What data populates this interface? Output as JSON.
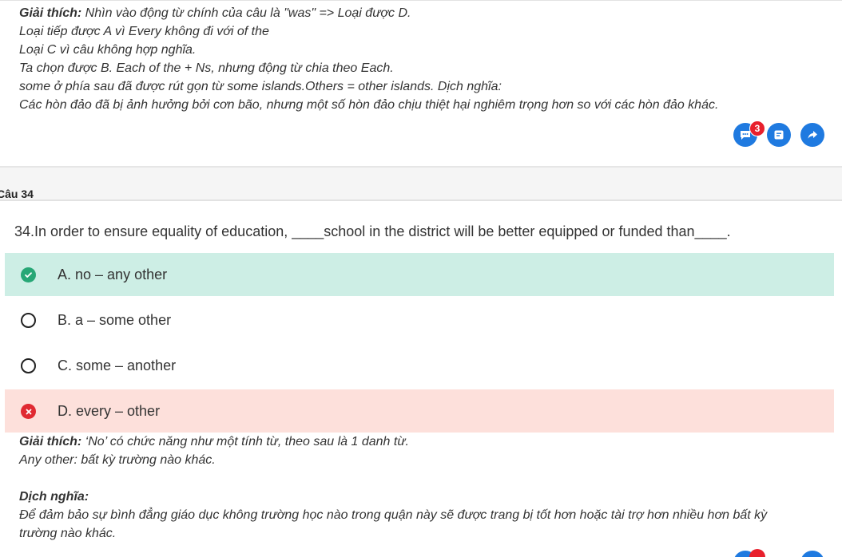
{
  "top_explanation": {
    "label": "Giải thích:",
    "first_line": " Nhìn vào động từ chính của câu là \"was\" => Loại được D.",
    "lines": [
      "Loại tiếp được A vì Every không đi với of the",
      "Loại C vì câu không hợp nghĩa.",
      "Ta chọn được B. Each of the + Ns, nhưng động từ chia theo Each.",
      "some ở phía sau đã được rút gọn từ some islands.Others = other islands. Dịch nghĩa:",
      "Các hòn đảo đã bị ảnh hưởng bởi cơn bão, nhưng một số hòn đảo chịu thiệt hại nghiêm trọng hơn so với các hòn đảo khác."
    ]
  },
  "actions": {
    "comment_badge_count": "3",
    "comment_icon": "comment-dots-icon",
    "note_icon": "note-icon",
    "share_icon": "share-arrow-icon",
    "accent_color": "#1f7ae0",
    "badge_color": "#e8202d"
  },
  "question": {
    "number_label": "Câu 34",
    "text": "34.In order to ensure equality of education, ____school in the district will be better equipped or funded than____."
  },
  "options": [
    {
      "label": "A. no – any other",
      "state": "correct"
    },
    {
      "label": "B. a – some other",
      "state": "unselected"
    },
    {
      "label": "C. some – another",
      "state": "unselected"
    },
    {
      "label": "D. every – other",
      "state": "wrong"
    }
  ],
  "bottom_explanation": {
    "label": "Giải thích:",
    "first_line": " ‘No’ có chức năng như một tính từ, theo sau là 1 danh từ.",
    "line2": "Any other: bất kỳ trường nào khác.",
    "translation_label": "Dịch nghĩa:",
    "translation_lines": [
      "Để đảm bảo sự bình đẳng giáo dục không trường học nào trong quận này sẽ được trang bị tốt hơn hoặc tài trợ hơn nhiều hơn bất kỳ",
      "trường nào khác."
    ]
  },
  "colors": {
    "correct_bg": "#cdeee5",
    "wrong_bg": "#fde0db",
    "check": "#27a776",
    "cross": "#e02a32"
  }
}
